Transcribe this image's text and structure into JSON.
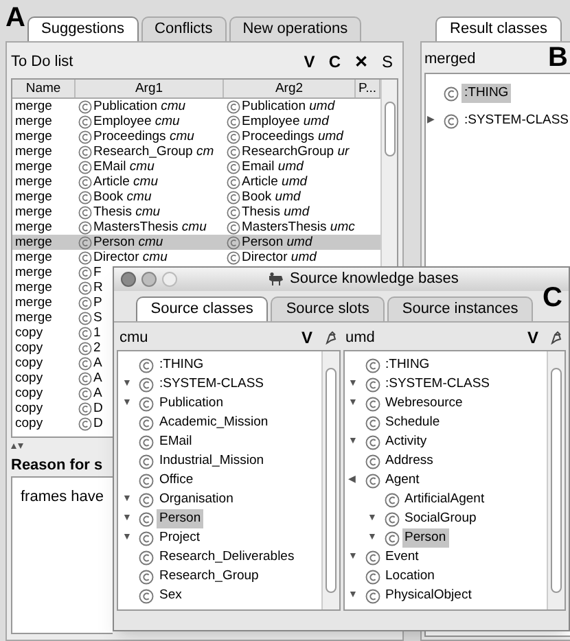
{
  "labels": [
    "A",
    "B",
    "C"
  ],
  "main_tabs": [
    {
      "label": "Suggestions",
      "selected": true
    },
    {
      "label": "Conflicts",
      "selected": false
    },
    {
      "label": "New operations",
      "selected": false
    }
  ],
  "todo": {
    "title": "To Do list",
    "tools": [
      "V",
      "C",
      "✕",
      "S"
    ],
    "columns": [
      "Name",
      "Arg1",
      "Arg2",
      "P..."
    ],
    "rows": [
      {
        "name": "merge",
        "arg1": "Publication *cmu*",
        "arg2": "Publication *umd*",
        "selected": false
      },
      {
        "name": "merge",
        "arg1": "Employee *cmu*",
        "arg2": "Employee *umd*",
        "selected": false
      },
      {
        "name": "merge",
        "arg1": "Proceedings *cmu*",
        "arg2": "Proceedings *umd*",
        "selected": false
      },
      {
        "name": "merge",
        "arg1": "Research_Group *cm*",
        "arg2": "ResearchGroup *ur*",
        "selected": false
      },
      {
        "name": "merge",
        "arg1": "EMail *cmu*",
        "arg2": "Email *umd*",
        "selected": false
      },
      {
        "name": "merge",
        "arg1": "Article *cmu*",
        "arg2": "Article *umd*",
        "selected": false
      },
      {
        "name": "merge",
        "arg1": "Book *cmu*",
        "arg2": "Book *umd*",
        "selected": false
      },
      {
        "name": "merge",
        "arg1": "Thesis *cmu*",
        "arg2": "Thesis *umd*",
        "selected": false
      },
      {
        "name": "merge",
        "arg1": "MastersThesis *cmu*",
        "arg2": "MastersThesis *umc*",
        "selected": false
      },
      {
        "name": "merge",
        "arg1": "Person *cmu*",
        "arg2": "Person *umd*",
        "selected": true
      },
      {
        "name": "merge",
        "arg1": "Director *cmu*",
        "arg2": "Director *umd*",
        "selected": false
      },
      {
        "name": "merge",
        "arg1": "F",
        "selected": false
      },
      {
        "name": "merge",
        "arg1": "R",
        "selected": false
      },
      {
        "name": "merge",
        "arg1": "P",
        "selected": false
      },
      {
        "name": "merge",
        "arg1": "S",
        "selected": false
      },
      {
        "name": "copy",
        "arg1": "1",
        "selected": false
      },
      {
        "name": "copy",
        "arg1": "2",
        "selected": false
      },
      {
        "name": "copy",
        "arg1": "A",
        "selected": false
      },
      {
        "name": "copy",
        "arg1": "A",
        "selected": false
      },
      {
        "name": "copy",
        "arg1": "A",
        "selected": false
      },
      {
        "name": "copy",
        "arg1": "D",
        "selected": false
      },
      {
        "name": "copy",
        "arg1": "D",
        "selected": false
      }
    ]
  },
  "reason": {
    "label": "Reason for s",
    "text": "frames have"
  },
  "result": {
    "tab": {
      "label": "Result classes",
      "selected": true
    },
    "title": "merged",
    "tree": [
      {
        "label": ":THING",
        "selected": true
      },
      {
        "label": ":SYSTEM-CLASS",
        "expander": "▶",
        "selected": false
      }
    ]
  },
  "source_window": {
    "title": "Source knowledge bases",
    "tabs": [
      {
        "label": "Source classes",
        "selected": true
      },
      {
        "label": "Source slots",
        "selected": false
      },
      {
        "label": "Source instances",
        "selected": false
      }
    ],
    "panes": [
      {
        "title": "cmu",
        "tool": "V",
        "tree": [
          {
            "label": ":THING",
            "selected": false
          },
          {
            "label": ":SYSTEM-CLASS",
            "expander": "▼",
            "selected": false
          },
          {
            "label": "Publication",
            "expander": "▼",
            "selected": false
          },
          {
            "label": "Academic_Mission",
            "selected": false
          },
          {
            "label": "EMail",
            "selected": false
          },
          {
            "label": "Industrial_Mission",
            "selected": false
          },
          {
            "label": "Office",
            "selected": false
          },
          {
            "label": "Organisation",
            "expander": "▼",
            "selected": false
          },
          {
            "label": "Person",
            "expander": "▼",
            "selected": true
          },
          {
            "label": "Project",
            "expander": "▼",
            "selected": false
          },
          {
            "label": "Research_Deliverables",
            "selected": false
          },
          {
            "label": "Research_Group",
            "selected": false
          },
          {
            "label": "Sex",
            "selected": false
          }
        ]
      },
      {
        "title": "umd",
        "tool": "V",
        "tree": [
          {
            "label": ":THING",
            "selected": false
          },
          {
            "label": ":SYSTEM-CLASS",
            "expander": "▼",
            "selected": false
          },
          {
            "label": "Webresource",
            "expander": "▼",
            "selected": false
          },
          {
            "label": "Schedule",
            "selected": false
          },
          {
            "label": "Activity",
            "expander": "▼",
            "selected": false
          },
          {
            "label": "Address",
            "selected": false
          },
          {
            "label": "Agent",
            "expander": "◀",
            "selected": false,
            "children": [
              {
                "label": "ArtificialAgent",
                "selected": false
              },
              {
                "label": "SocialGroup",
                "expander": "▼",
                "selected": false
              },
              {
                "label": "Person",
                "expander": "▼",
                "selected": true
              }
            ]
          },
          {
            "label": "Event",
            "expander": "▼",
            "selected": false
          },
          {
            "label": "Location",
            "selected": false
          },
          {
            "label": "PhysicalObject",
            "expander": "▼",
            "selected": false
          }
        ]
      }
    ]
  }
}
